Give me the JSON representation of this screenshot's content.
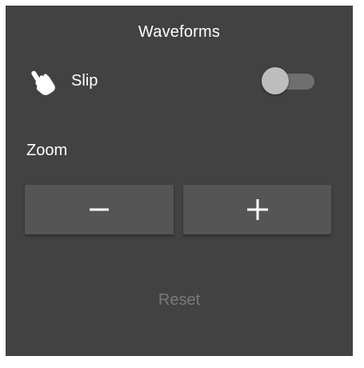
{
  "panel": {
    "title": "Waveforms",
    "background": "#424242"
  },
  "slip": {
    "icon": "hand-pointer-icon",
    "label": "Slip",
    "enabled": false
  },
  "zoom": {
    "label": "Zoom",
    "out_icon": "minus-icon",
    "in_icon": "plus-icon"
  },
  "reset": {
    "label": "Reset",
    "disabled": true
  }
}
